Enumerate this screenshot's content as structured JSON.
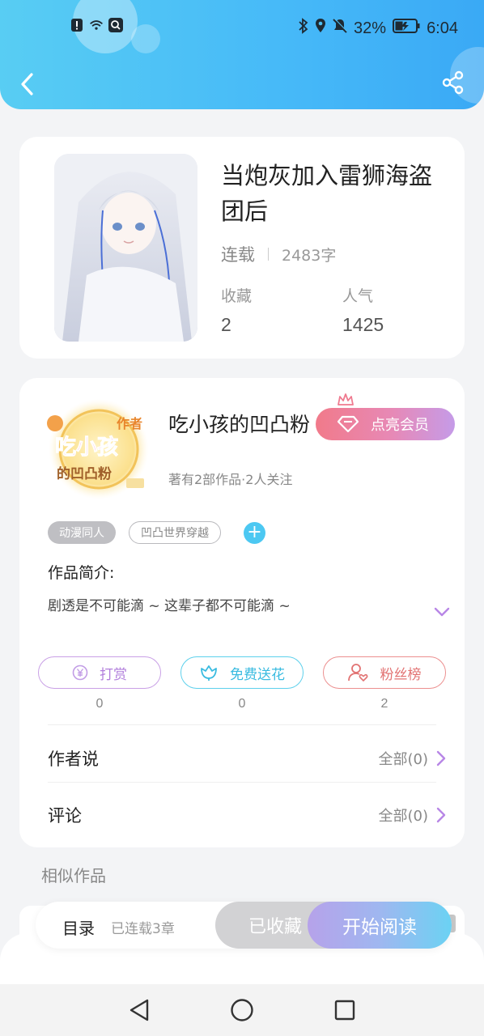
{
  "status_bar": {
    "battery": "32%",
    "time": "6:04",
    "icons": [
      "alert-icon",
      "wifi-icon",
      "search-app-icon",
      "bluetooth-icon",
      "location-icon",
      "mute-icon",
      "battery-icon"
    ]
  },
  "header": {
    "back_icon": "chevron-left-icon",
    "share_icon": "share-icon",
    "gradient": [
      "#58cdf3",
      "#3aa9f5"
    ]
  },
  "book": {
    "title": "当炮灰加入雷狮海盗团后",
    "status": "连载",
    "word_count": "2483字",
    "favorites_label": "收藏",
    "favorites_value": "2",
    "popularity_label": "人气",
    "popularity_value": "1425"
  },
  "author": {
    "avatar_text_top": "作者",
    "avatar_text_main": "吃小孩",
    "avatar_text_sub": "的凹凸粉",
    "name": "吃小孩的凹凸粉",
    "vip_label": "点亮会员",
    "summary": "著有2部作品·2人关注",
    "tags": [
      "动漫同人",
      "凹凸世界穿越"
    ],
    "add_tag": "+",
    "intro_title": "作品简介:",
    "intro_text": "剧透是不可能滴 ~ 这辈子都不可能滴 ~"
  },
  "actions": [
    {
      "label": "打赏",
      "count": "0",
      "icon": "yen-coin-icon",
      "color": "#b27fdc"
    },
    {
      "label": "免费送花",
      "count": "0",
      "icon": "flower-icon",
      "color": "#39bbe0"
    },
    {
      "label": "粉丝榜",
      "count": "2",
      "icon": "user-heart-icon",
      "color": "#e27373"
    }
  ],
  "rows": {
    "author_says_label": "作者说",
    "author_says_right": "全部(0)",
    "comments_label": "评论",
    "comments_right": "全部(0)"
  },
  "similar_title": "相似作品",
  "bottom_bar": {
    "catalog": "目录",
    "chapters": "已连载3章",
    "favorited": "已收藏",
    "start_reading": "开始阅读"
  },
  "navbar": {
    "icons": [
      "back-triangle-icon",
      "home-circle-icon",
      "recents-square-icon"
    ]
  }
}
